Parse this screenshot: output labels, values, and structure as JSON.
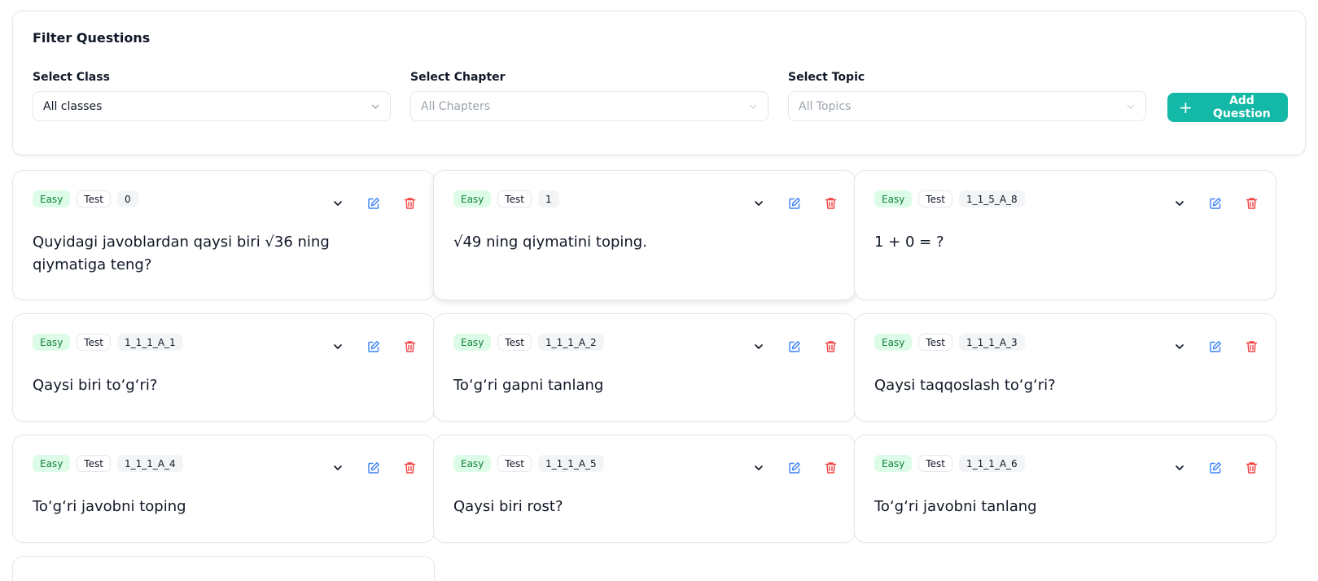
{
  "filter": {
    "title": "Filter Questions",
    "class_label": "Select Class",
    "class_value": "All classes",
    "chapter_label": "Select Chapter",
    "chapter_value": "All Chapters",
    "topic_label": "Select Topic",
    "topic_value": "All Topics",
    "add_button": "Add Question",
    "add_icon": "+"
  },
  "colors": {
    "accent": "#14b8a6",
    "easy_bg": "#dcfce7",
    "easy_text": "#15803d",
    "edit": "#3b82f6",
    "delete": "#ef4444"
  },
  "icons": {
    "expand": "chevron-down-icon",
    "edit": "edit-icon",
    "delete": "trash-icon"
  },
  "cards": [
    {
      "difficulty": "Easy",
      "type": "Test",
      "code": "0",
      "question": "Quyidagi javoblardan qaysi biri √36 ning qiymatiga teng?"
    },
    {
      "difficulty": "Easy",
      "type": "Test",
      "code": "1",
      "question": "√49 ning qiymatini toping."
    },
    {
      "difficulty": "Easy",
      "type": "Test",
      "code": "1_1_5_A_8",
      "question": "1 + 0 = ?"
    },
    {
      "difficulty": "Easy",
      "type": "Test",
      "code": "1_1_1_A_1",
      "question": "Qaysi biri to‘g‘ri?"
    },
    {
      "difficulty": "Easy",
      "type": "Test",
      "code": "1_1_1_A_2",
      "question": "To‘g‘ri gapni tanlang"
    },
    {
      "difficulty": "Easy",
      "type": "Test",
      "code": "1_1_1_A_3",
      "question": "Qaysi taqqoslash to‘g‘ri?"
    },
    {
      "difficulty": "Easy",
      "type": "Test",
      "code": "1_1_1_A_4",
      "question": "To‘g‘ri javobni toping"
    },
    {
      "difficulty": "Easy",
      "type": "Test",
      "code": "1_1_1_A_5",
      "question": "Qaysi biri rost?"
    },
    {
      "difficulty": "Easy",
      "type": "Test",
      "code": "1_1_1_A_6",
      "question": "To‘g‘ri javobni tanlang"
    }
  ]
}
